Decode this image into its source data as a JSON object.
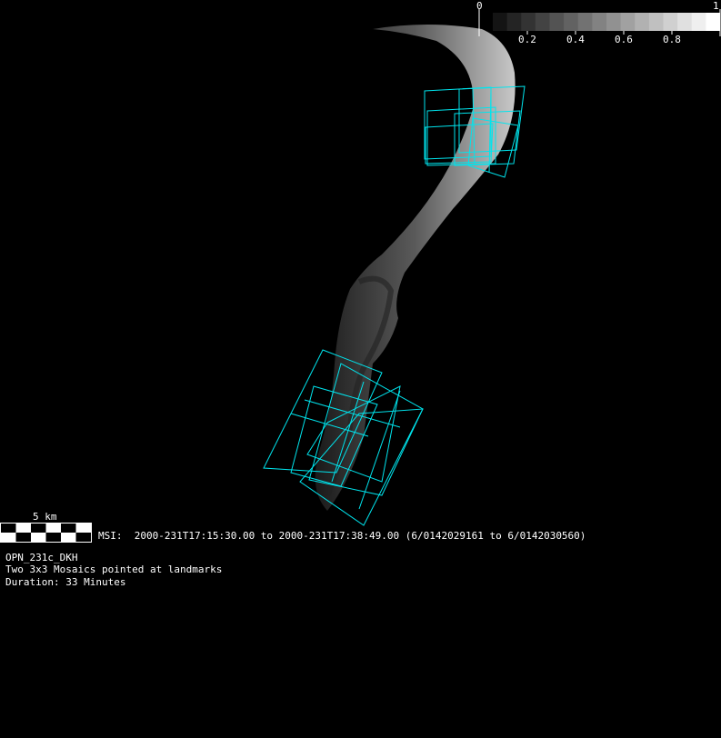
{
  "colorbar": {
    "min_label": "0",
    "max_label": "1",
    "tick_labels": [
      "0.2",
      "0.4",
      "0.6",
      "0.8"
    ],
    "steps": 16
  },
  "scale_bar": {
    "label": "5 km"
  },
  "observation": {
    "instrument_line": "MSI:  2000-231T17:15:30.00 to 2000-231T17:38:49.00 (6/0142029161 to 6/0142030560)",
    "sequence_name": "OPN_231c_DKH",
    "description": "Two 3x3 Mosaics pointed at landmarks",
    "duration": "Duration: 33 Minutes"
  },
  "colors": {
    "footprint": "#00e5ee",
    "background": "#000000"
  }
}
